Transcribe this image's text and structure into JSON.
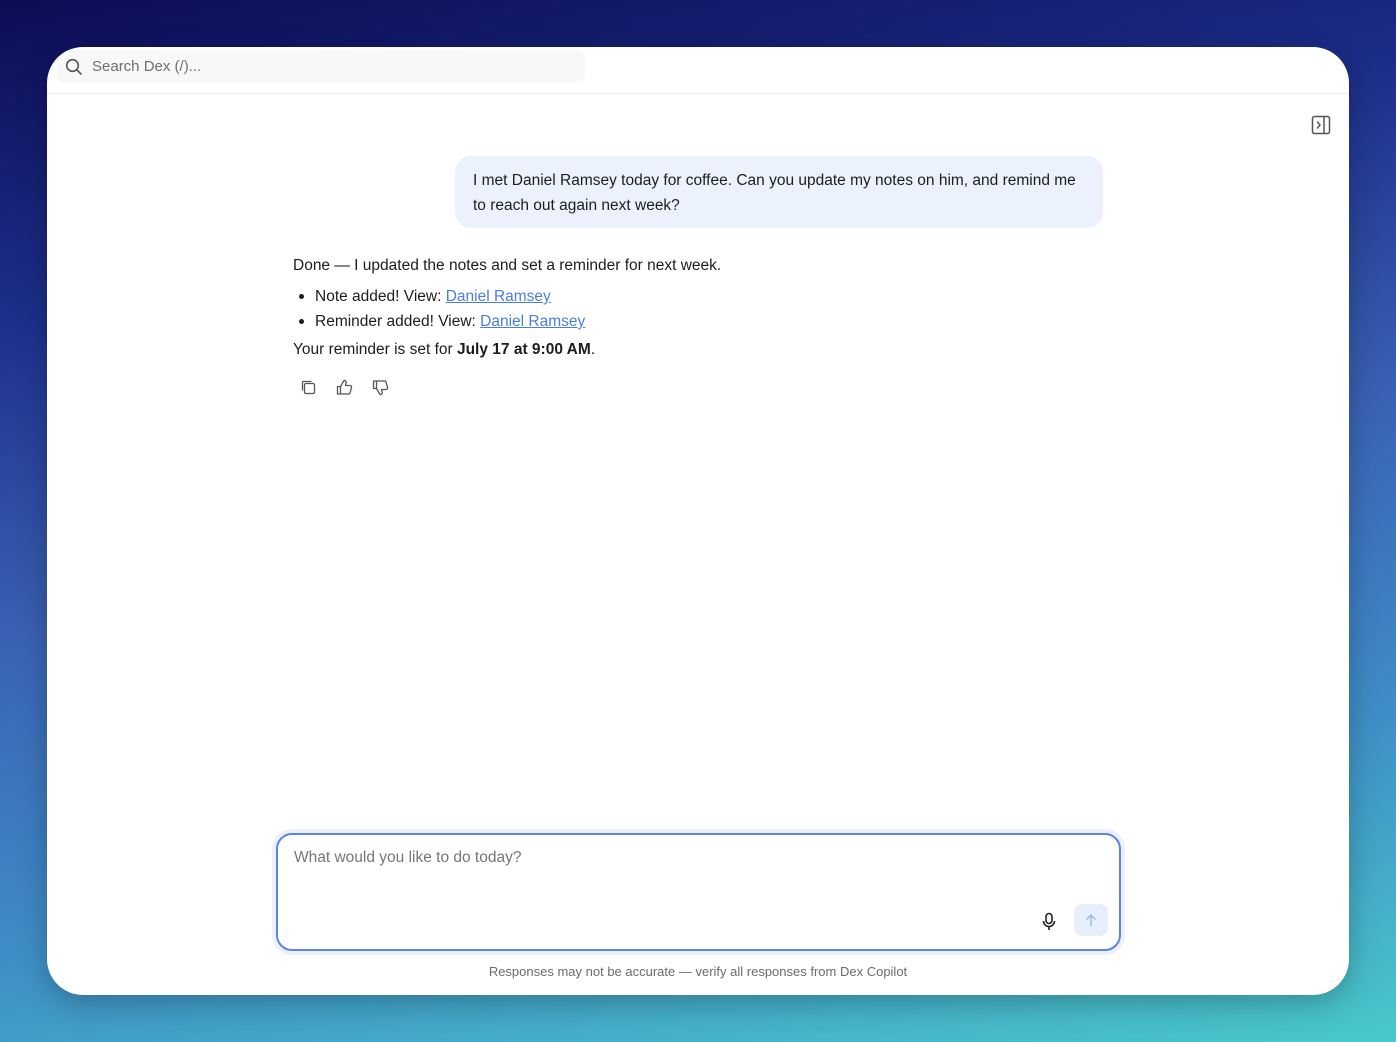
{
  "search": {
    "placeholder": "Search Dex (/)..."
  },
  "user_message": "I met Daniel Ramsey today for coffee. Can you update my notes on him, and remind me to reach out again next week?",
  "reply": {
    "intro": "Done — I updated the notes and set a reminder for next week.",
    "items": [
      {
        "prefix": "Note added! View: ",
        "link": "Daniel Ramsey"
      },
      {
        "prefix": "Reminder added! View: ",
        "link": "Daniel Ramsey"
      }
    ],
    "summary_prefix": "Your reminder is set for ",
    "summary_bold": "July 17 at 9:00 AM",
    "summary_suffix": "."
  },
  "composer": {
    "placeholder": "What would you like to do today?"
  },
  "disclaimer": "Responses may not be accurate — verify all responses from Dex Copilot",
  "icons": {
    "search": "search-icon",
    "panel_toggle": "sidebar-toggle-icon",
    "copy": "copy-icon",
    "thumbs_up": "thumbs-up-icon",
    "thumbs_down": "thumbs-down-icon",
    "mic": "microphone-icon",
    "send": "arrow-up-icon"
  },
  "colors": {
    "accent": "#5a84e6",
    "link": "#4a7fe0",
    "user_bubble": "#ecf2fd"
  }
}
